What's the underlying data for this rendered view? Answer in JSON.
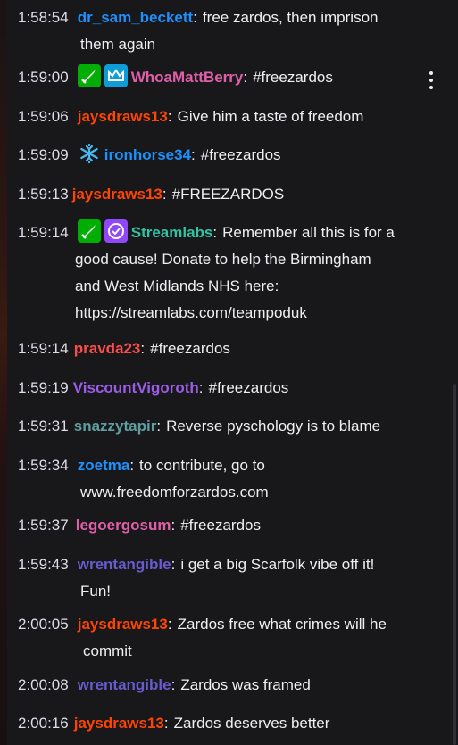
{
  "colors": {
    "background": "#18181b",
    "text": "#efeff1",
    "mod_badge": "#00ad03",
    "prime_badge": "#0e9dd9",
    "verified_badge": "#9147ff"
  },
  "messages": [
    {
      "time": "1:58:54",
      "user": "dr_sam_beckett",
      "color": "#1e90ff",
      "text": "free zardos, then imprison",
      "text2": "them again"
    },
    {
      "time": "1:59:00",
      "user": "WhoaMattBerry",
      "color": "#e05fa8",
      "text": "#freezardos",
      "badges": [
        "sword-icon",
        "crown-icon"
      ]
    },
    {
      "time": "1:59:06",
      "user": "jaysdraws13",
      "color": "#ff4500",
      "text": "Give him a taste of freedom"
    },
    {
      "time": "1:59:09",
      "user": "ironhorse34",
      "color": "#1e90ff",
      "text": "#freezardos",
      "badges": [
        "snowflake-icon"
      ]
    },
    {
      "time": "1:59:13",
      "user": "jaysdraws13",
      "color": "#ff4500",
      "text": "#FREEZARDOS"
    },
    {
      "time": "1:59:14",
      "user": "Streamlabs",
      "color": "#31c3a2",
      "text": "Remember all this is for a",
      "text2": "good cause! Donate to help the Birmingham",
      "text3": "and West Midlands NHS here:",
      "text4": "https://streamlabs.com/teampoduk",
      "badges": [
        "sword-icon",
        "verified-icon"
      ]
    },
    {
      "time": "1:59:14",
      "user": "pravda23",
      "color": "#ff4d4d",
      "text": "#freezardos"
    },
    {
      "time": "1:59:19",
      "user": "ViscountVigoroth",
      "color": "#9b5de5",
      "text": "#freezardos"
    },
    {
      "time": "1:59:31",
      "user": "snazzytapir",
      "color": "#5f9ea0",
      "text": "Reverse pyschology is to blame"
    },
    {
      "time": "1:59:34",
      "user": "zoetma",
      "color": "#1e90ff",
      "text": "to contribute, go to",
      "text2": "www.freedomforzardos.com"
    },
    {
      "time": "1:59:37",
      "user": "legoergosum",
      "color": "#e05fa8",
      "text": "#freezardos"
    },
    {
      "time": "1:59:43",
      "user": "wrentangible",
      "color": "#6a5acd",
      "text": "i get a big Scarfolk vibe off it!",
      "text2": "Fun!"
    },
    {
      "time": "2:00:05",
      "user": "jaysdraws13",
      "color": "#ff4500",
      "text": "Zardos free what crimes will he",
      "text2": "commit"
    },
    {
      "time": "2:00:08",
      "user": "wrentangible",
      "color": "#6a5acd",
      "text": "Zardos was framed"
    },
    {
      "time": "2:00:16",
      "user": "jaysdraws13",
      "color": "#ff4500",
      "text": "Zardos deserves better"
    }
  ]
}
